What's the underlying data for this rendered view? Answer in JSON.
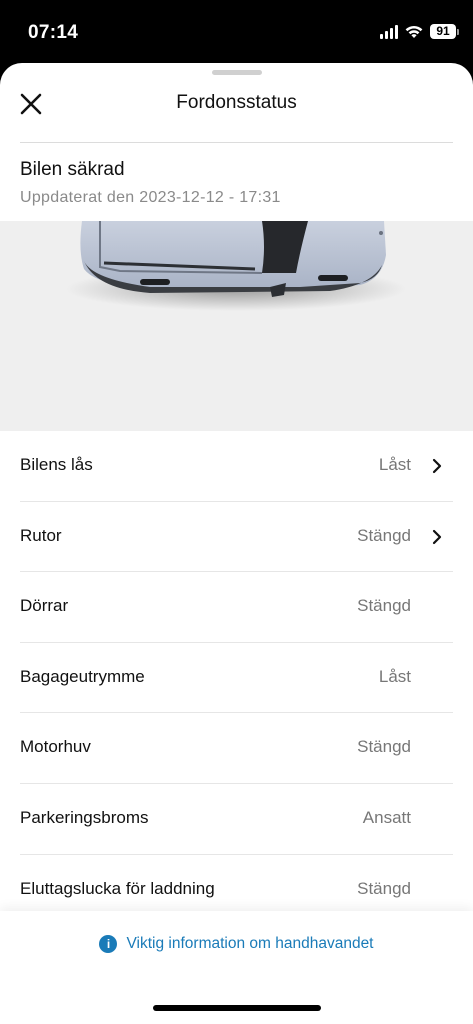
{
  "status_bar": {
    "time": "07:14",
    "battery": "91"
  },
  "header": {
    "title": "Fordonsstatus"
  },
  "summary": {
    "title": "Bilen säkrad",
    "updated": "Uppdaterat den 2023-12-12 - 17:31"
  },
  "status_items": [
    {
      "label": "Bilens lås",
      "value": "Låst",
      "has_chevron": true
    },
    {
      "label": "Rutor",
      "value": "Stängd",
      "has_chevron": true
    },
    {
      "label": "Dörrar",
      "value": "Stängd",
      "has_chevron": false
    },
    {
      "label": "Bagageutrymme",
      "value": "Låst",
      "has_chevron": false
    },
    {
      "label": "Motorhuv",
      "value": "Stängd",
      "has_chevron": false
    },
    {
      "label": "Parkeringsbroms",
      "value": "Ansatt",
      "has_chevron": false
    },
    {
      "label": "Eluttagslucka för laddning",
      "value": "Stängd",
      "has_chevron": false
    }
  ],
  "footer": {
    "info_link": "Viktig information om handhavandet"
  },
  "colors": {
    "accent": "#1a7bb8",
    "car_body": "#b9c2d4"
  }
}
